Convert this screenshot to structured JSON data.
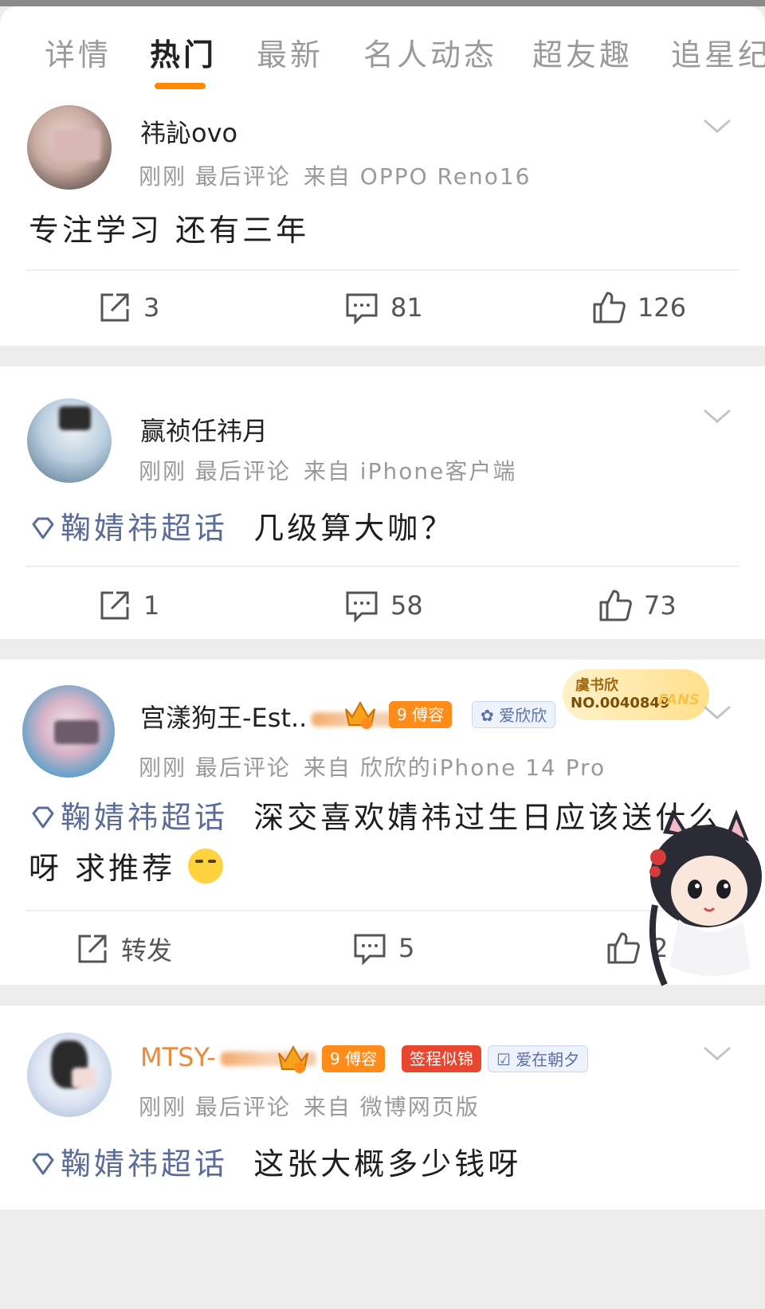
{
  "tabs": [
    {
      "label": "详情",
      "active": false
    },
    {
      "label": "热门",
      "active": true
    },
    {
      "label": "最新",
      "active": false
    },
    {
      "label": "名人动态",
      "active": false
    },
    {
      "label": "超友趣",
      "active": false
    },
    {
      "label": "追星纪",
      "active": false
    }
  ],
  "accent_color": "#ff8a00",
  "topic_color": "#5b6c9c",
  "posts": [
    {
      "username": "祎訫ovo",
      "meta_time": "刚刚 最后评论",
      "meta_source": "来自 OPPO Reno16",
      "content": "专注学习 还有三年",
      "repost": "3",
      "comments": "81",
      "likes": "126"
    },
    {
      "username": "赢祯任祎月",
      "meta_time": "刚刚 最后评论",
      "meta_source": "来自 iPhone客户端",
      "topic": "鞠婧祎超话",
      "content": "几级算大咖？",
      "repost": "1",
      "comments": "58",
      "likes": "73"
    },
    {
      "username": "宫漾狗王-Est..",
      "meta_time": "刚刚 最后评论",
      "meta_source": "来自 欣欣的iPhone 14 Pro",
      "badge_level": "9",
      "badge_title": "傅容",
      "badge_club": "爱欣欣",
      "fans_name": "虞书欣",
      "fans_no": "NO.0040849",
      "fans_tag": "FANS",
      "topic": "鞠婧祎超话",
      "content": "深交喜欢婧祎过生日应该送什么呀 求推荐",
      "repost": "转发",
      "comments": "5",
      "likes": "2"
    },
    {
      "username": "MTSY-",
      "meta_time": "刚刚 最后评论",
      "meta_source": "来自 微博网页版",
      "badge_level": "9",
      "badge_title": "傅容",
      "badge_sign": "签程似锦",
      "badge_club": "爱在朝夕",
      "topic": "鞠婧祎超话",
      "content": "这张大概多少钱呀"
    }
  ],
  "icons": {
    "repost": "share-square-icon",
    "comment": "comment-bubble-icon",
    "like": "thumbs-up-icon",
    "chevron": "chevron-down-icon",
    "topic": "diamond-icon"
  }
}
